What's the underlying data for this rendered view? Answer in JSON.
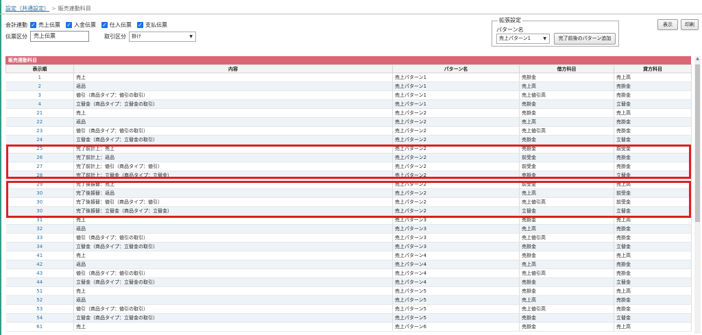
{
  "breadcrumb": {
    "link": "設定（共通設定）",
    "separator": ">",
    "current": "販売連動科目"
  },
  "filters": {
    "kaikei_label": "会計連動",
    "checkboxes": [
      {
        "label": "売上伝票",
        "checked": true
      },
      {
        "label": "入金伝票",
        "checked": true
      },
      {
        "label": "仕入伝票",
        "checked": true
      },
      {
        "label": "支払伝票",
        "checked": true
      }
    ],
    "denpyo_label": "伝票区分",
    "denpyo_value": "売上伝票",
    "torihiki_label": "取引区分",
    "torihiki_value": "掛け"
  },
  "extension": {
    "legend": "拡張設定",
    "pattern_label": "パターン名",
    "pattern_value": "売上パターン1",
    "add_button": "完了前後のパターン追加"
  },
  "toolbar": {
    "show": "表示",
    "print": "印刷"
  },
  "section_title": "販売連動科目",
  "table": {
    "headers": [
      "表示順",
      "内容",
      "パターン名",
      "借方科目",
      "貸方科目"
    ],
    "rows": [
      [
        "1",
        "売上",
        "売上パターン1",
        "売掛金",
        "売上高"
      ],
      [
        "2",
        "返品",
        "売上パターン1",
        "売上高",
        "売掛金"
      ],
      [
        "3",
        "値引（商品タイプ：値引の取引）",
        "売上パターン1",
        "売上値引高",
        "売掛金"
      ],
      [
        "4",
        "立替金（商品タイプ：立替金の取引）",
        "売上パターン1",
        "売掛金",
        "立替金"
      ],
      [
        "21",
        "売上",
        "売上パターン2",
        "売掛金",
        "売上高"
      ],
      [
        "22",
        "返品",
        "売上パターン2",
        "売上高",
        "売掛金"
      ],
      [
        "23",
        "値引（商品タイプ：値引の取引）",
        "売上パターン2",
        "売上値引高",
        "売掛金"
      ],
      [
        "24",
        "立替金（商品タイプ：立替金の取引）",
        "売上パターン2",
        "売掛金",
        "立替金"
      ],
      [
        "25",
        "完了前計上：売上",
        "売上パターン2",
        "売掛金",
        "前受金"
      ],
      [
        "26",
        "完了前計上：返品",
        "売上パターン2",
        "前受金",
        "売掛金"
      ],
      [
        "27",
        "完了前計上：値引（商品タイプ：値引）",
        "売上パターン2",
        "前受金",
        "売掛金"
      ],
      [
        "28",
        "完了前計上：立替金（商品タイプ：立替金）",
        "売上パターン2",
        "売掛金",
        "立替金"
      ],
      [
        "29",
        "完了後振替：売上",
        "売上パターン2",
        "前受金",
        "売上高"
      ],
      [
        "30",
        "完了後振替：返品",
        "売上パターン2",
        "売上高",
        "前受金"
      ],
      [
        "30",
        "完了後振替：値引（商品タイプ：値引）",
        "売上パターン2",
        "売上値引高",
        "前受金"
      ],
      [
        "30",
        "完了後振替：立替金（商品タイプ：立替金）",
        "売上パターン2",
        "立替金",
        "立替金"
      ],
      [
        "31",
        "売上",
        "売上パターン3",
        "売掛金",
        "売上高"
      ],
      [
        "32",
        "返品",
        "売上パターン3",
        "売上高",
        "売掛金"
      ],
      [
        "33",
        "値引（商品タイプ：値引の取引）",
        "売上パターン3",
        "売上値引高",
        "売掛金"
      ],
      [
        "34",
        "立替金（商品タイプ：立替金の取引）",
        "売上パターン3",
        "売掛金",
        "立替金"
      ],
      [
        "41",
        "売上",
        "売上パターン4",
        "売掛金",
        "売上高"
      ],
      [
        "42",
        "返品",
        "売上パターン4",
        "売上高",
        "売掛金"
      ],
      [
        "43",
        "値引（商品タイプ：値引の取引）",
        "売上パターン4",
        "売上値引高",
        "売掛金"
      ],
      [
        "44",
        "立替金（商品タイプ：立替金の取引）",
        "売上パターン4",
        "売掛金",
        "立替金"
      ],
      [
        "51",
        "売上",
        "売上パターン5",
        "売掛金",
        "売上高"
      ],
      [
        "52",
        "返品",
        "売上パターン5",
        "売上高",
        "売掛金"
      ],
      [
        "53",
        "値引（商品タイプ：値引の取引）",
        "売上パターン5",
        "売上値引高",
        "売掛金"
      ],
      [
        "54",
        "立替金（商品タイプ：立替金の取引）",
        "売上パターン5",
        "売掛金",
        "立替金"
      ],
      [
        "61",
        "売上",
        "売上パターン6",
        "売掛金",
        "売上高"
      ]
    ]
  },
  "colors": {
    "section_header": "#d96674",
    "highlight_border": "#e01e1e",
    "link": "#2a6ea6",
    "checkbox": "#1a73e8"
  }
}
